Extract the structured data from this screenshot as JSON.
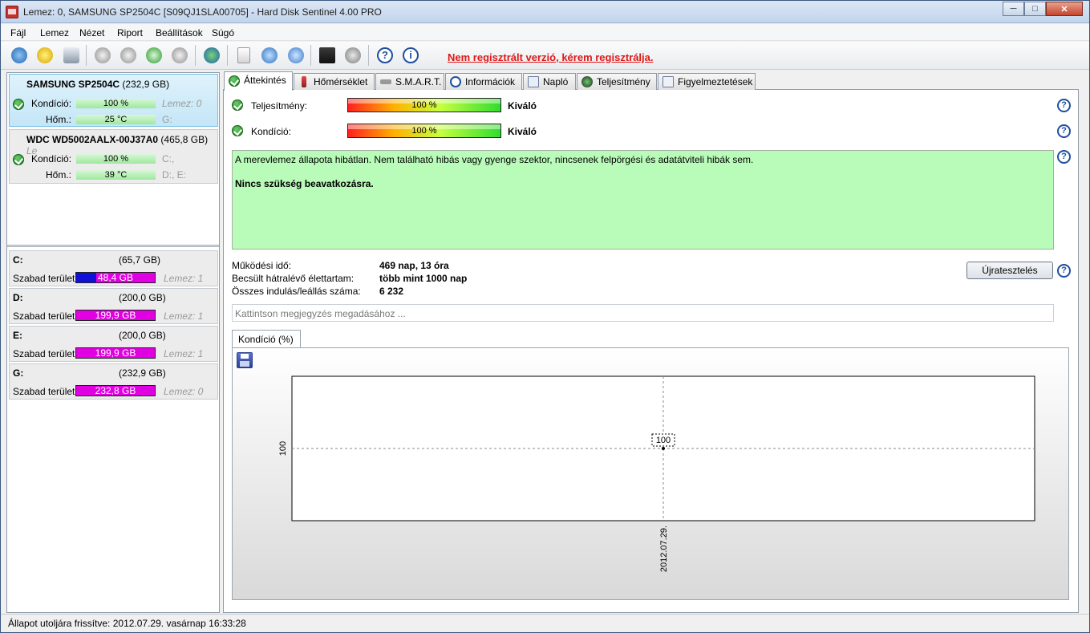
{
  "window": {
    "title": "Lemez: 0, SAMSUNG SP2504C [S09QJ1SLA00705]  -  Hard Disk Sentinel 4.00 PRO"
  },
  "menu": [
    "Fájl",
    "Lemez",
    "Nézet",
    "Riport",
    "Beállítások",
    "Súgó"
  ],
  "toolbar": {
    "icons": [
      "refresh-icon",
      "warning-icon",
      "disk-icon",
      "probe-icon-1",
      "probe-icon-2",
      "probe-icon-3",
      "probe-icon-4",
      "web-icon",
      "report-icon",
      "sync-icon",
      "network-icon",
      "test-icon",
      "sound-icon",
      "help-icon",
      "info-icon"
    ],
    "register_warning": "Nem regisztrált verzió, kérem regisztrálja."
  },
  "disks": [
    {
      "name": "SAMSUNG SP2504C",
      "size": "(232,9 GB)",
      "condition_label": "Kondíció:",
      "condition": "100 %",
      "condition_value": 100,
      "temp_label": "Hőm.:",
      "temp": "25 °C",
      "extra1": "Lemez: 0",
      "extra2": "G:"
    },
    {
      "name": "WDC WD5002AALX-00J37A0",
      "size": "(465,8 GB)",
      "condition_label": "Kondíció:",
      "condition": "100 %",
      "condition_value": 100,
      "temp_label": "Hőm.:",
      "temp": "39 °C",
      "extra1": "C:,",
      "extra2": "D:, E:",
      "cut": "Le"
    }
  ],
  "volumes": [
    {
      "name": "C:",
      "size": "(65,7 GB)",
      "free_label": "Szabad terület",
      "free": "48,4 GB",
      "used_fraction": 0.26,
      "disk": "Lemez: 1"
    },
    {
      "name": "D:",
      "size": "(200,0 GB)",
      "free_label": "Szabad terület",
      "free": "199,9 GB",
      "used_fraction": 0.0,
      "disk": "Lemez: 1"
    },
    {
      "name": "E:",
      "size": "(200,0 GB)",
      "free_label": "Szabad terület",
      "free": "199,9 GB",
      "used_fraction": 0.0,
      "disk": "Lemez: 1"
    },
    {
      "name": "G:",
      "size": "(232,9 GB)",
      "free_label": "Szabad terület",
      "free": "232,8 GB",
      "used_fraction": 0.0,
      "disk": "Lemez: 0"
    }
  ],
  "tabs": [
    "Áttekintés",
    "Hőmérséklet",
    "S.M.A.R.T.",
    "Információk",
    "Napló",
    "Teljesítmény",
    "Figyelmeztetések"
  ],
  "overview": {
    "performance_label": "Teljesítmény:",
    "performance_value": "100 %",
    "performance_rating": "Kiváló",
    "condition_label": "Kondíció:",
    "condition_value": "100 %",
    "condition_rating": "Kiváló",
    "status_text": "A merevlemez állapota hibátlan. Nem található hibás vagy gyenge szektor, nincsenek felpörgési és adatátviteli hibák sem.",
    "status_action": "Nincs szükség beavatkozásra.",
    "uptime_label": "Működési idő:",
    "uptime": "469 nap, 13 óra",
    "lifetime_label": "Becsült hátralévő élettartam:",
    "lifetime": "több mint 1000 nap",
    "starts_label": "Összes indulás/leállás száma:",
    "starts": "6 232",
    "retest_button": "Újratesztelés",
    "note_placeholder": "Kattintson megjegyzés megadásához ..."
  },
  "chart_tab": "Kondíció  (%)",
  "chart_data": {
    "type": "line",
    "x": [
      "2012.07.29."
    ],
    "series": [
      {
        "values": [
          100
        ]
      }
    ],
    "ytick": "100",
    "xtick": "2012.07.29.",
    "point_label": "100"
  },
  "statusbar": "Állapot utoljára frissítve: 2012.07.29. vasárnap 16:33:28"
}
